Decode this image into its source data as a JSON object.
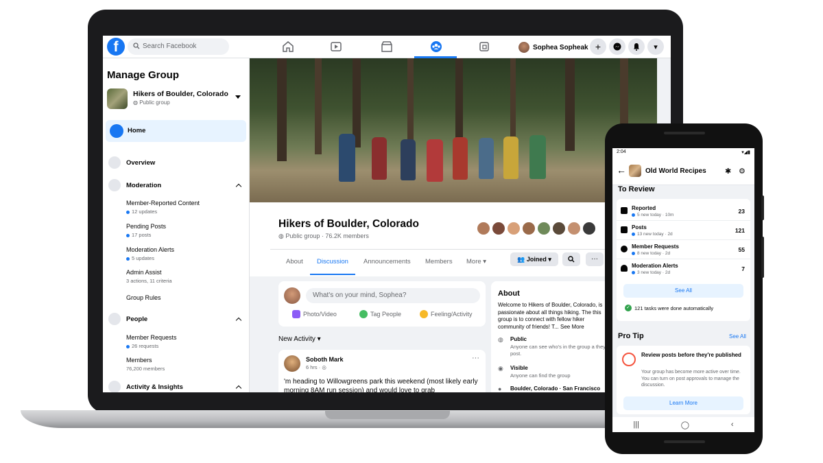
{
  "desktop": {
    "search_placeholder": "Search Facebook",
    "user_name": "Sophea Sopheak",
    "create_symbol": "+",
    "menu_symbol": "▾",
    "sidebar": {
      "title": "Manage Group",
      "group_name": "Hikers of Boulder, Colorado",
      "group_privacy": "Public group",
      "home": "Home",
      "overview": "Overview",
      "moderation": "Moderation",
      "moderation_items": [
        {
          "label": "Member-Reported Content",
          "meta": "12 updates"
        },
        {
          "label": "Pending Posts",
          "meta": "17 posts"
        },
        {
          "label": "Moderation Alerts",
          "meta": "5 updates"
        },
        {
          "label": "Admin Assist",
          "meta": "3 actions, 11 criteria"
        },
        {
          "label": "Group Rules",
          "meta": ""
        }
      ],
      "people": "People",
      "people_items": [
        {
          "label": "Member Requests",
          "meta": "26 requests"
        },
        {
          "label": "Members",
          "meta": "76,200 members"
        }
      ],
      "activity": "Activity & Insights"
    },
    "group": {
      "title": "Hikers of Boulder, Colorado",
      "subtitle": "Public group · 76.2K members",
      "tabs": [
        "About",
        "Discussion",
        "Announcements",
        "Members",
        "More ▾"
      ],
      "joined": "Joined",
      "more_symbol": "···"
    },
    "composer": {
      "placeholder": "What's on your mind, Sophea?",
      "photo": "Photo/Video",
      "tag": "Tag People",
      "feeling": "Feeling/Activity"
    },
    "new_activity": "New Activity ▾",
    "post": {
      "author": "Soboth Mark",
      "meta": "6 hrs · ◎",
      "more": "···",
      "text": "'m heading to Willowgreens park this weekend (most likely early morning 8AM run session) and would love to grab"
    },
    "about": {
      "title": "About",
      "body": "Welcome to Hikers of Boulder, Colorado, is passionate about all things hiking. The this group is to connect with fellow hiker community of friends! T... See More",
      "public_t": "Public",
      "public_s": "Anyone can see who's in the group a they post.",
      "visible_t": "Visible",
      "visible_s": "Anyone can find the group",
      "location": "Boulder, Colorado · San Francisco"
    }
  },
  "phone": {
    "time": "2:04",
    "title": "Old World Recipes",
    "to_review": "To Review",
    "rows": [
      {
        "label": "Reported",
        "meta": "5 new today · 10m",
        "count": "23"
      },
      {
        "label": "Posts",
        "meta": "13 new today · 2d",
        "count": "121"
      },
      {
        "label": "Member Requests",
        "meta": "8 new today · 2d",
        "count": "55"
      },
      {
        "label": "Moderation Alerts",
        "meta": "3 new today · 2d",
        "count": "7"
      }
    ],
    "see_all_btn": "See All",
    "auto_done": "121 tasks were done automatically",
    "pro_tip": "Pro Tip",
    "pro_see_all": "See All",
    "tip_title": "Review posts before they're published",
    "tip_body": "Your group has become more active over time. You can turn on post approvals to manage the discussion.",
    "learn_more": "Learn More",
    "nav": [
      "|||",
      "◯",
      "‹"
    ]
  }
}
